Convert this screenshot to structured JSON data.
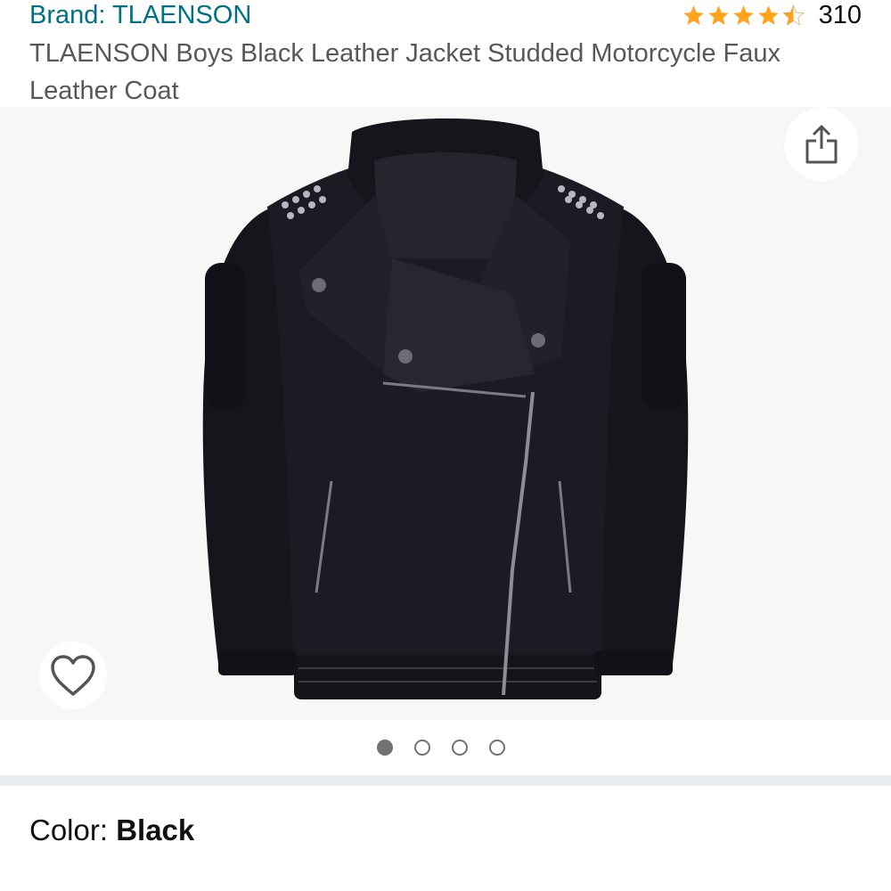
{
  "header": {
    "brand_link": "Brand: TLAENSON",
    "rating_value": 4.5,
    "rating_stars": 5,
    "review_count": "310",
    "product_title": "TLAENSON Boys Black Leather Jacket Studded Motorcycle Faux Leather Coat"
  },
  "gallery": {
    "image_description_icon": "jacket-image",
    "share_icon": "share-icon",
    "favorite_icon": "heart-icon",
    "page_count": 4,
    "current_page": 1
  },
  "variation": {
    "color_label": "Color: ",
    "color_value": "Black"
  },
  "colors": {
    "brand_link": "#007185",
    "star": "#ffa41c",
    "title_text": "#565959",
    "gallery_bg": "#f7f7f7",
    "dot": "#6f7373"
  }
}
